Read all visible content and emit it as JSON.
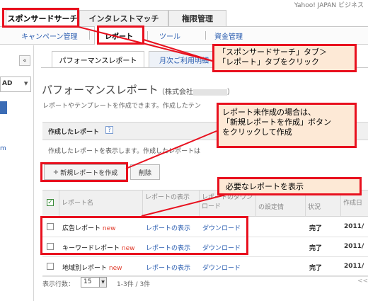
{
  "top_link": "Yahoo! JAPAN ビジネス",
  "main_tabs": [
    {
      "label": "スポンサードサーチ"
    },
    {
      "label": "インタレストマッチ"
    },
    {
      "label": "権限管理"
    }
  ],
  "sub_tabs": [
    {
      "label": "キャンペーン管理"
    },
    {
      "label": "レポート"
    },
    {
      "label": "ツール"
    },
    {
      "label": "資金管理"
    }
  ],
  "sidebar": {
    "collapse": "«",
    "select_value": "AD",
    "select_arrow": "▼",
    "link_text": "m"
  },
  "report_tabs": [
    {
      "label": "パフォーマンスレポート"
    },
    {
      "label": "月次ご利用明細"
    }
  ],
  "page": {
    "title": "パフォーマンスレポート",
    "company_prefix": "（株式会社",
    "company_suffix": "）",
    "description": "レポートやテンプレートを作成できます。作成したテン"
  },
  "section": {
    "title": "作成したレポート",
    "help": "?",
    "description": "作成したレポートを表示します。作成したレポートは"
  },
  "buttons": {
    "create_icon": "+",
    "create": "新規レポートを作成",
    "delete": "削除"
  },
  "table": {
    "check_all": "✓",
    "columns": [
      "レポート名",
      "レポートの表示",
      "レポートのダウンロード",
      "の設定情",
      "状況",
      "作成日"
    ],
    "rows": [
      {
        "name": "広告レポート",
        "new": "new",
        "view": "レポートの表示",
        "download": "ダウンロード",
        "status": "完了",
        "date": "2011/"
      },
      {
        "name": "キーワードレポート",
        "new": "new",
        "view": "レポートの表示",
        "download": "ダウンロード",
        "status": "完了",
        "date": "2011/"
      },
      {
        "name": "地域別レポート",
        "new": "new",
        "view": "レポートの表示",
        "download": "ダウンロード",
        "status": "完了",
        "date": "2011/"
      }
    ]
  },
  "pager": {
    "label": "表示行数：",
    "value": "15",
    "arrow": "▼",
    "count": "1-3件 / 3件",
    "nav": "<<"
  },
  "annotations": {
    "tab_instruction_line1": "「スポンサードサーチ」タブ＞",
    "tab_instruction_line2": "「レポート」タブをクリック",
    "create_instruction_line1": "レポート未作成の場合は、",
    "create_instruction_line2": "「新規レポートを作成」ボタン",
    "create_instruction_line3": "をクリックして作成",
    "view_instruction": "必要なレポートを表示"
  },
  "colors": {
    "annotation_red": "#e8101e",
    "annotation_fill": "#fde9d6",
    "link_blue": "#2a5db0",
    "new_red": "#e03a2a"
  }
}
